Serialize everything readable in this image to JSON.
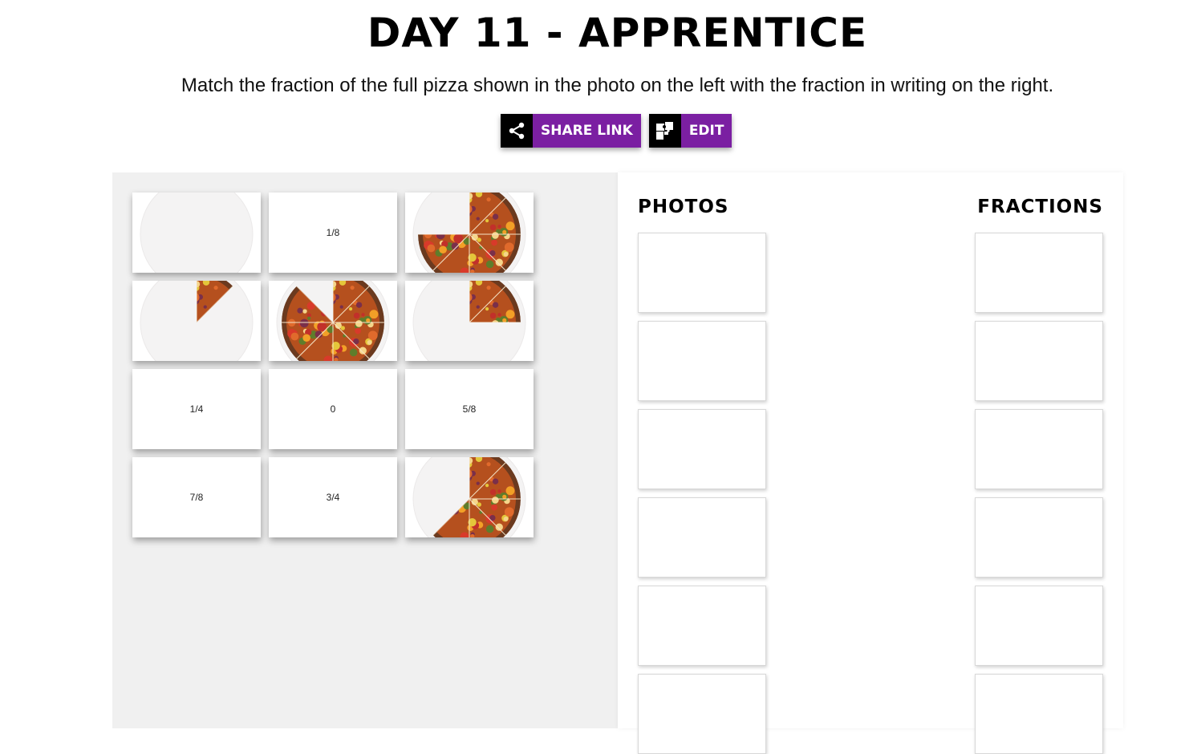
{
  "header": {
    "title": "DAY 11 - APPRENTICE",
    "instructions": "Match the fraction of the full pizza shown in the photo on the left with the fraction in writing on the right."
  },
  "buttons": {
    "share_label": "SHARE LINK",
    "edit_label": "EDIT"
  },
  "tiles": [
    {
      "kind": "photo",
      "pizza_fraction_shown": 0
    },
    {
      "kind": "text",
      "label": "1/8"
    },
    {
      "kind": "photo",
      "pizza_fraction_shown": 0.75
    },
    {
      "kind": "photo",
      "pizza_fraction_shown": 0.125
    },
    {
      "kind": "photo",
      "pizza_fraction_shown": 0.875
    },
    {
      "kind": "photo",
      "pizza_fraction_shown": 0.25
    },
    {
      "kind": "text",
      "label": "1/4"
    },
    {
      "kind": "text",
      "label": "0"
    },
    {
      "kind": "text",
      "label": "5/8"
    },
    {
      "kind": "text",
      "label": "7/8"
    },
    {
      "kind": "text",
      "label": "3/4"
    },
    {
      "kind": "photo",
      "pizza_fraction_shown": 0.625
    }
  ],
  "match_panel": {
    "photos_heading": "PHOTOS",
    "fractions_heading": "FRACTIONS"
  },
  "colors": {
    "accent": "#7b1fa2",
    "icon_bg": "#000000",
    "pool_bg": "#f0f0f0"
  },
  "icons": {
    "share": "share-icon",
    "edit": "puzzle-icon"
  }
}
